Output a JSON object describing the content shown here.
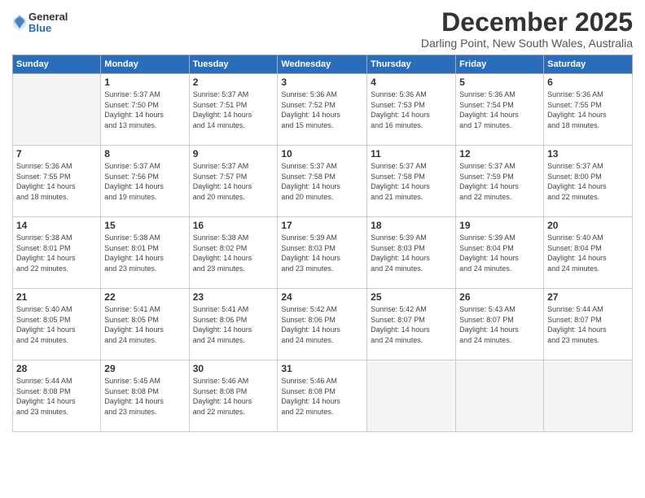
{
  "logo": {
    "general": "General",
    "blue": "Blue"
  },
  "title": "December 2025",
  "location": "Darling Point, New South Wales, Australia",
  "weekdays": [
    "Sunday",
    "Monday",
    "Tuesday",
    "Wednesday",
    "Thursday",
    "Friday",
    "Saturday"
  ],
  "weeks": [
    [
      {
        "day": "",
        "info": ""
      },
      {
        "day": "1",
        "info": "Sunrise: 5:37 AM\nSunset: 7:50 PM\nDaylight: 14 hours\nand 13 minutes."
      },
      {
        "day": "2",
        "info": "Sunrise: 5:37 AM\nSunset: 7:51 PM\nDaylight: 14 hours\nand 14 minutes."
      },
      {
        "day": "3",
        "info": "Sunrise: 5:36 AM\nSunset: 7:52 PM\nDaylight: 14 hours\nand 15 minutes."
      },
      {
        "day": "4",
        "info": "Sunrise: 5:36 AM\nSunset: 7:53 PM\nDaylight: 14 hours\nand 16 minutes."
      },
      {
        "day": "5",
        "info": "Sunrise: 5:36 AM\nSunset: 7:54 PM\nDaylight: 14 hours\nand 17 minutes."
      },
      {
        "day": "6",
        "info": "Sunrise: 5:36 AM\nSunset: 7:55 PM\nDaylight: 14 hours\nand 18 minutes."
      }
    ],
    [
      {
        "day": "7",
        "info": "Sunrise: 5:36 AM\nSunset: 7:55 PM\nDaylight: 14 hours\nand 18 minutes."
      },
      {
        "day": "8",
        "info": "Sunrise: 5:37 AM\nSunset: 7:56 PM\nDaylight: 14 hours\nand 19 minutes."
      },
      {
        "day": "9",
        "info": "Sunrise: 5:37 AM\nSunset: 7:57 PM\nDaylight: 14 hours\nand 20 minutes."
      },
      {
        "day": "10",
        "info": "Sunrise: 5:37 AM\nSunset: 7:58 PM\nDaylight: 14 hours\nand 20 minutes."
      },
      {
        "day": "11",
        "info": "Sunrise: 5:37 AM\nSunset: 7:58 PM\nDaylight: 14 hours\nand 21 minutes."
      },
      {
        "day": "12",
        "info": "Sunrise: 5:37 AM\nSunset: 7:59 PM\nDaylight: 14 hours\nand 22 minutes."
      },
      {
        "day": "13",
        "info": "Sunrise: 5:37 AM\nSunset: 8:00 PM\nDaylight: 14 hours\nand 22 minutes."
      }
    ],
    [
      {
        "day": "14",
        "info": "Sunrise: 5:38 AM\nSunset: 8:01 PM\nDaylight: 14 hours\nand 22 minutes."
      },
      {
        "day": "15",
        "info": "Sunrise: 5:38 AM\nSunset: 8:01 PM\nDaylight: 14 hours\nand 23 minutes."
      },
      {
        "day": "16",
        "info": "Sunrise: 5:38 AM\nSunset: 8:02 PM\nDaylight: 14 hours\nand 23 minutes."
      },
      {
        "day": "17",
        "info": "Sunrise: 5:39 AM\nSunset: 8:03 PM\nDaylight: 14 hours\nand 23 minutes."
      },
      {
        "day": "18",
        "info": "Sunrise: 5:39 AM\nSunset: 8:03 PM\nDaylight: 14 hours\nand 24 minutes."
      },
      {
        "day": "19",
        "info": "Sunrise: 5:39 AM\nSunset: 8:04 PM\nDaylight: 14 hours\nand 24 minutes."
      },
      {
        "day": "20",
        "info": "Sunrise: 5:40 AM\nSunset: 8:04 PM\nDaylight: 14 hours\nand 24 minutes."
      }
    ],
    [
      {
        "day": "21",
        "info": "Sunrise: 5:40 AM\nSunset: 8:05 PM\nDaylight: 14 hours\nand 24 minutes."
      },
      {
        "day": "22",
        "info": "Sunrise: 5:41 AM\nSunset: 8:05 PM\nDaylight: 14 hours\nand 24 minutes."
      },
      {
        "day": "23",
        "info": "Sunrise: 5:41 AM\nSunset: 8:06 PM\nDaylight: 14 hours\nand 24 minutes."
      },
      {
        "day": "24",
        "info": "Sunrise: 5:42 AM\nSunset: 8:06 PM\nDaylight: 14 hours\nand 24 minutes."
      },
      {
        "day": "25",
        "info": "Sunrise: 5:42 AM\nSunset: 8:07 PM\nDaylight: 14 hours\nand 24 minutes."
      },
      {
        "day": "26",
        "info": "Sunrise: 5:43 AM\nSunset: 8:07 PM\nDaylight: 14 hours\nand 24 minutes."
      },
      {
        "day": "27",
        "info": "Sunrise: 5:44 AM\nSunset: 8:07 PM\nDaylight: 14 hours\nand 23 minutes."
      }
    ],
    [
      {
        "day": "28",
        "info": "Sunrise: 5:44 AM\nSunset: 8:08 PM\nDaylight: 14 hours\nand 23 minutes."
      },
      {
        "day": "29",
        "info": "Sunrise: 5:45 AM\nSunset: 8:08 PM\nDaylight: 14 hours\nand 23 minutes."
      },
      {
        "day": "30",
        "info": "Sunrise: 5:46 AM\nSunset: 8:08 PM\nDaylight: 14 hours\nand 22 minutes."
      },
      {
        "day": "31",
        "info": "Sunrise: 5:46 AM\nSunset: 8:08 PM\nDaylight: 14 hours\nand 22 minutes."
      },
      {
        "day": "",
        "info": ""
      },
      {
        "day": "",
        "info": ""
      },
      {
        "day": "",
        "info": ""
      }
    ]
  ]
}
